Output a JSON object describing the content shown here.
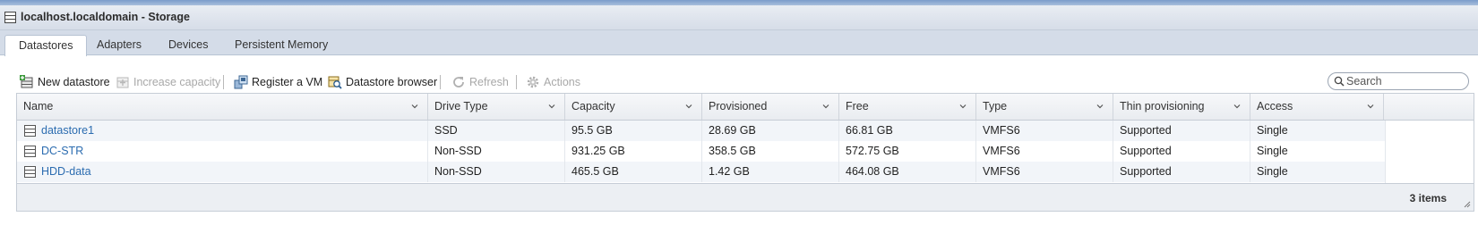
{
  "window": {
    "title": "localhost.localdomain - Storage"
  },
  "tabs": [
    {
      "label": "Datastores",
      "active": true
    },
    {
      "label": "Adapters",
      "active": false
    },
    {
      "label": "Devices",
      "active": false
    },
    {
      "label": "Persistent Memory",
      "active": false
    }
  ],
  "toolbar": {
    "new_datastore": "New datastore",
    "increase_capacity": "Increase capacity",
    "register_vm": "Register a VM",
    "datastore_browser": "Datastore browser",
    "refresh": "Refresh",
    "actions": "Actions"
  },
  "search": {
    "placeholder": "Search"
  },
  "table": {
    "columns": [
      "Name",
      "Drive Type",
      "Capacity",
      "Provisioned",
      "Free",
      "Type",
      "Thin provisioning",
      "Access"
    ],
    "rows": [
      {
        "name": "datastore1",
        "drive_type": "SSD",
        "capacity": "95.5 GB",
        "provisioned": "28.69 GB",
        "free": "66.81 GB",
        "type": "VMFS6",
        "thin": "Supported",
        "access": "Single"
      },
      {
        "name": "DC-STR",
        "drive_type": "Non-SSD",
        "capacity": "931.25 GB",
        "provisioned": "358.5 GB",
        "free": "572.75 GB",
        "type": "VMFS6",
        "thin": "Supported",
        "access": "Single"
      },
      {
        "name": "HDD-data",
        "drive_type": "Non-SSD",
        "capacity": "465.5 GB",
        "provisioned": "1.42 GB",
        "free": "464.08 GB",
        "type": "VMFS6",
        "thin": "Supported",
        "access": "Single"
      }
    ],
    "footer_count": "3 items"
  },
  "colors": {
    "link": "#2b6cb0",
    "tabbar": "#d4dce8",
    "disabled": "#a8a8a8"
  },
  "icons": [
    "datastore-icon",
    "new-datastore-icon",
    "increase-capacity-icon",
    "register-vm-icon",
    "datastore-browser-icon",
    "refresh-icon",
    "gear-icon",
    "search-icon",
    "chevron-down-icon",
    "resize-grip-icon"
  ]
}
